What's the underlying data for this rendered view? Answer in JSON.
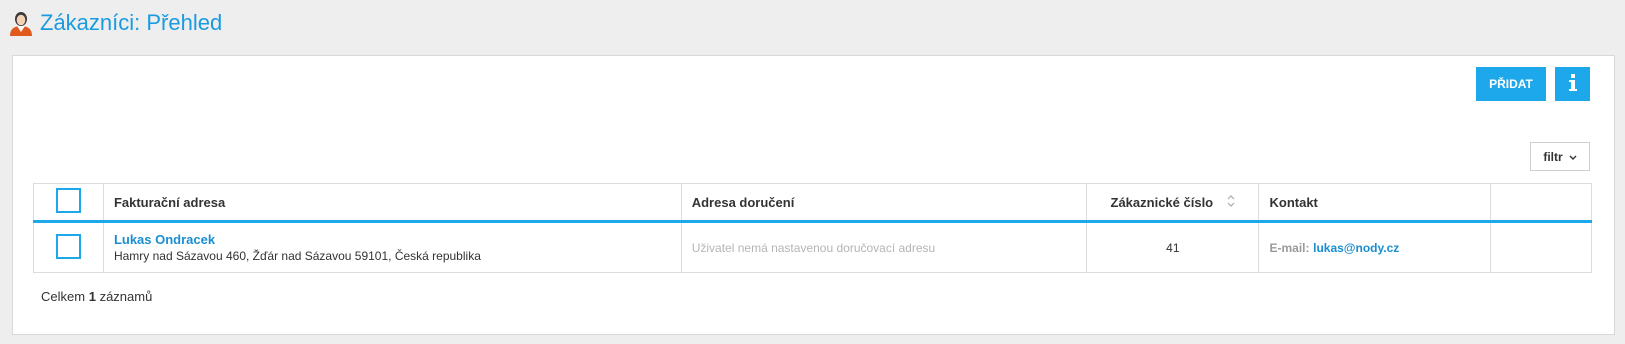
{
  "header": {
    "title": "Zákazníci: Přehled",
    "icon": "user-avatar-icon"
  },
  "toolbar": {
    "add_label": "PŘIDAT",
    "info_icon": "info-icon",
    "filter_label": "filtr",
    "accent_color": "#1ea8ec"
  },
  "table": {
    "columns": {
      "billing": "Fakturační adresa",
      "shipping": "Adresa doručení",
      "customer_number": "Zákaznické číslo",
      "contact": "Kontakt",
      "extra": ""
    },
    "rows": [
      {
        "name": "Lukas Ondracek",
        "address": "Hamry nad Sázavou 460, Žďár nad Sázavou 59101, Česká republika",
        "shipping": "Uživatel nemá nastavenou doručovací adresu",
        "customer_number": "41",
        "contact_label": "E-mail:",
        "contact_email": "lukas@nody.cz"
      }
    ]
  },
  "footer": {
    "prefix": "Celkem",
    "count": "1",
    "suffix": "záznamů"
  }
}
